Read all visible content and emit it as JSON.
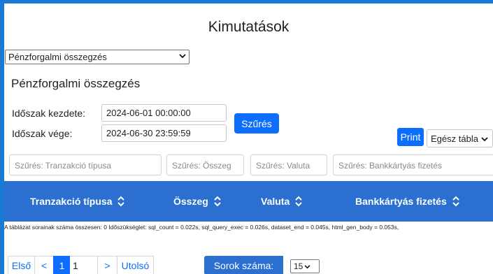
{
  "page": {
    "title": "Kimutatások"
  },
  "report_select": {
    "value": "Pénzforgalmi összegzés"
  },
  "report": {
    "title": "Pénzforgalmi összegzés"
  },
  "period": {
    "start_label": "Időszak kezdete:",
    "start_value": "2024-06-01 00:00:00",
    "end_label": "Időszak vége:",
    "end_value": "2024-06-30 23:59:59"
  },
  "filter_button": {
    "label": "Szűrés"
  },
  "print_button": {
    "label": "Print"
  },
  "scope_select": {
    "value": "Egész tábla"
  },
  "column_filters": [
    {
      "placeholder": "Szűrés: Tranzakció típusa"
    },
    {
      "placeholder": "Szűrés: Összeg"
    },
    {
      "placeholder": "Szűrés: Valuta"
    },
    {
      "placeholder": "Szűrés: Bankkártyás fizetés"
    }
  ],
  "columns": [
    {
      "label": "Tranzakció típusa"
    },
    {
      "label": "Összeg"
    },
    {
      "label": "Valuta"
    },
    {
      "label": "Bankkártyás fizetés"
    }
  ],
  "stats": {
    "text": "A táblázat sorainak száma összesen: 0   Időszükséglet: sql_count = 0.022s, sql_query_exec = 0.026s, dataset_end = 0.045s, html_gen_body = 0.053s,"
  },
  "pagination": {
    "first": "Első",
    "prev": "<",
    "current": "1",
    "total": "1",
    "next": ">",
    "last": "Utolsó"
  },
  "rows": {
    "label": "Sorok száma:",
    "value": "15"
  },
  "colors": {
    "background": "#1a7ad6",
    "header": "#2b6fd0",
    "primary": "#0d6efd"
  },
  "icons": {
    "sort": "sort-up-down-icon",
    "dropdown": "chevron-down-icon"
  }
}
